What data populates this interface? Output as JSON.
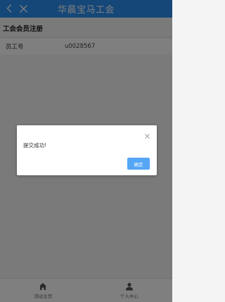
{
  "header": {
    "title": "华晨宝马工会",
    "back_icon": "chevron-left-icon",
    "close_icon": "close-icon"
  },
  "form": {
    "section_title": "工会会员注册",
    "employee_id_label": "员工号",
    "employee_id_value": "u0028567"
  },
  "dialog": {
    "message": "提交成功!",
    "ok_label": "确定",
    "close_icon": "close-icon"
  },
  "tabbar": {
    "items": [
      {
        "label": "活动主页",
        "icon": "home-icon"
      },
      {
        "label": "个人中心",
        "icon": "user-icon"
      }
    ]
  },
  "colors": {
    "header_bg": "#2b8ef0",
    "button_bg": "#55a6f5",
    "overlay": "rgba(0,0,0,0.5)"
  }
}
